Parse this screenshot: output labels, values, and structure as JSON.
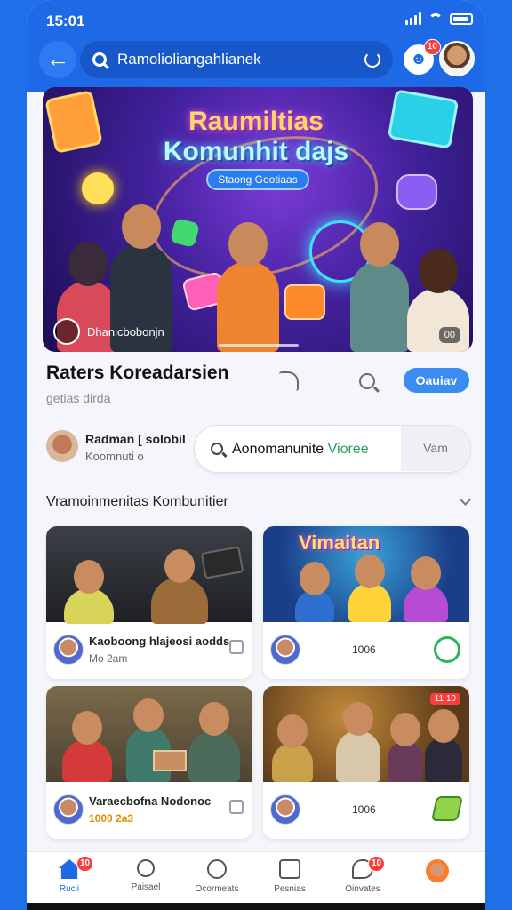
{
  "status": {
    "time": "15:01"
  },
  "topbar": {
    "search_text": "Ramolioliangahlianek",
    "notif_badge": "10"
  },
  "hero": {
    "title_line1": "Raumiltias",
    "title_line2": "Komunhit dajs",
    "pill": "Staong Gootiaas",
    "caption": "Dhanicbobonjn",
    "counter": "00"
  },
  "info": {
    "title": "Raters Koreadarsien",
    "subtitle": "getias dirda",
    "follow_label": "Oauiav"
  },
  "creator": {
    "name": "Radman [ solobil",
    "meta": "Koomnuti o",
    "search_text": "Aonomanunite",
    "search_highlight": "Vioree",
    "search_action": "Vam"
  },
  "section": {
    "title": "Vramoinmenitas Kombunitier"
  },
  "cards": [
    {
      "title": "Kaoboong hlajeosi aodds",
      "meta": "Mo 2am"
    },
    {
      "thumb_label": "Vimaitan",
      "mid": "1006"
    },
    {
      "title": "Varaecbofna Nodonoc",
      "meta": "1000 2a3"
    },
    {
      "thumb_badge": "11 10",
      "mid": "1006"
    }
  ],
  "tabbar": {
    "items": [
      {
        "label": "Rucii",
        "badge": "10"
      },
      {
        "label": "Paisael"
      },
      {
        "label": "Ocormeats"
      },
      {
        "label": "Pesnias"
      },
      {
        "label": "Oinvates",
        "badge": "10"
      },
      {
        "label": ""
      }
    ]
  },
  "colors": {
    "accent": "#1e6ae6",
    "badge": "#ff3b3b",
    "green": "#2fb35a"
  }
}
